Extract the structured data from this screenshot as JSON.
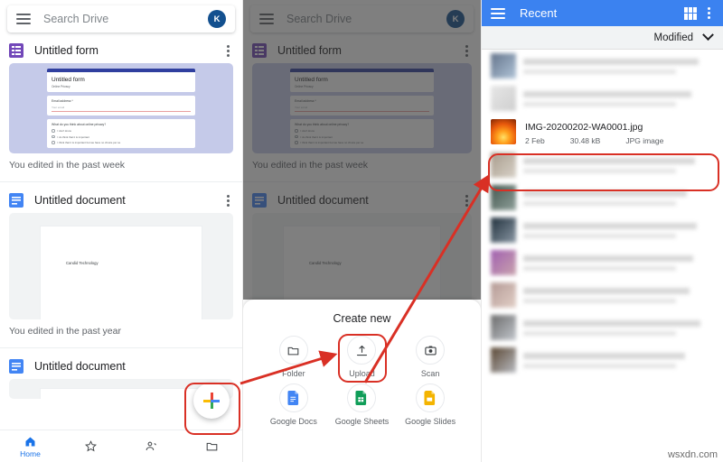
{
  "left_panel": {
    "search": {
      "placeholder": "Search Drive",
      "menu_icon": "hamburger-icon",
      "avatar_initial": "K"
    },
    "cards": [
      {
        "title": "Untitled form",
        "icon": "google-forms-icon",
        "edited": "You edited in the past week",
        "thumbnail": {
          "form_title": "Untitled form",
          "form_subtitle": "Online Privacy",
          "field_label": "Email address *",
          "field_placeholder": "Your email",
          "question": "What do you think about online privacy?",
          "options": [
            "I don't know",
            "I do think that it is important",
            "I think that it is important but we have no choice per se"
          ]
        }
      },
      {
        "title": "Untitled document",
        "icon": "google-docs-icon",
        "edited": "You edited in the past year",
        "thumbnail": {
          "body_text": "Candid Technology"
        }
      },
      {
        "title": "Untitled document",
        "icon": "google-docs-icon",
        "edited": "",
        "thumbnail": {
          "body_text": ""
        }
      }
    ],
    "fab": {
      "name": "create-new-fab",
      "label": "+"
    },
    "bottom_nav": [
      {
        "label": "Home",
        "icon": "home-icon",
        "active": true
      },
      {
        "label": "",
        "icon": "star-icon",
        "active": false
      },
      {
        "label": "",
        "icon": "shared-people-icon",
        "active": false
      },
      {
        "label": "",
        "icon": "folder-icon",
        "active": false
      }
    ]
  },
  "mid_panel": {
    "sheet": {
      "title": "Create new",
      "items": [
        {
          "label": "Folder",
          "icon": "folder-icon"
        },
        {
          "label": "Upload",
          "icon": "upload-icon"
        },
        {
          "label": "Scan",
          "icon": "camera-scan-icon"
        },
        {
          "label": "Google Docs",
          "icon": "google-docs-icon"
        },
        {
          "label": "Google Sheets",
          "icon": "google-sheets-icon"
        },
        {
          "label": "Google Slides",
          "icon": "google-slides-icon"
        }
      ]
    }
  },
  "right_panel": {
    "header": {
      "title": "Recent",
      "menu_icon": "hamburger-icon",
      "grid_icon": "grid-view-icon",
      "overflow_icon": "more-vert-icon"
    },
    "sort": {
      "label": "Modified",
      "icon": "chevron-down-icon"
    },
    "highlighted_file": {
      "name": "IMG-20200202-WA0001.jpg",
      "date": "2 Feb",
      "size": "30.48 kB",
      "type": "JPG image"
    },
    "blurred_row_count": 9,
    "watermark": "wsxdn.com"
  },
  "colors": {
    "brand_blue": "#3b82f0",
    "accent_blue": "#1a73e8",
    "annotation_red": "#d93025",
    "forms_purple": "#7248b9",
    "docs_blue": "#4285f4",
    "sheets_green": "#0f9d58",
    "slides_yellow": "#f4b400"
  }
}
